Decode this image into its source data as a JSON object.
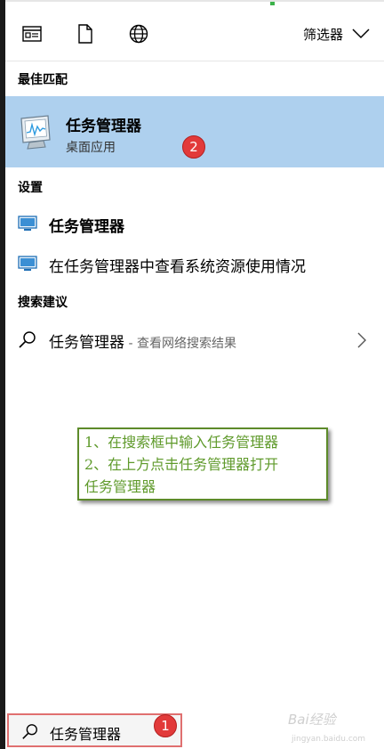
{
  "toolbar": {
    "filter_label": "筛选器"
  },
  "sections": {
    "best_match": "最佳匹配",
    "settings": "设置",
    "search_suggestions": "搜索建议"
  },
  "best_match_item": {
    "title": "任务管理器",
    "subtitle": "桌面应用"
  },
  "settings_items": [
    {
      "label": "任务管理器"
    },
    {
      "label": "在任务管理器中查看系统资源使用情况"
    }
  ],
  "suggestion": {
    "label": "任务管理器",
    "suffix": " - 查看网络搜索结果"
  },
  "callout": {
    "line1": "1、在搜索框中输入任务管理器",
    "line2": "2、在上方点击任务管理器打开",
    "line3": "任务管理器"
  },
  "badges": {
    "one": "1",
    "two": "2"
  },
  "search": {
    "value": "任务管理器"
  },
  "watermark": {
    "brand": "Bai经验",
    "url": "jingyan.baidu.com"
  }
}
